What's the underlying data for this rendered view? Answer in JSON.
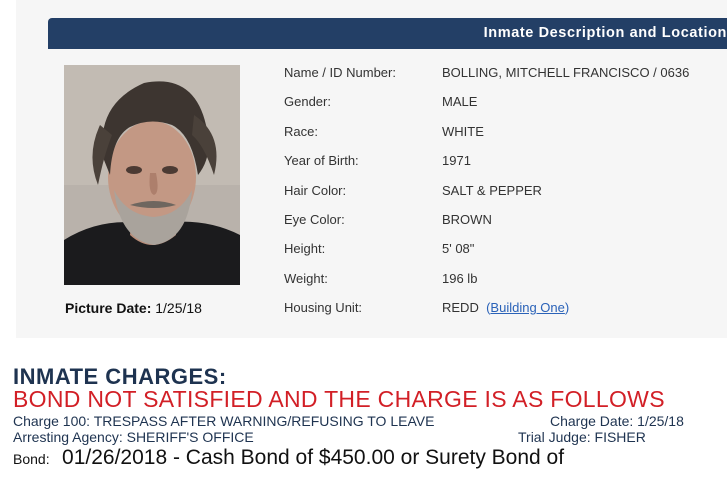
{
  "header": {
    "title": "Inmate Description and Location"
  },
  "photo": {
    "alt": "inmate-mugshot"
  },
  "picture_date": {
    "label": "Picture Date:",
    "value": "1/25/18"
  },
  "details": [
    {
      "label": "Name / ID Number:",
      "value": "BOLLING, MITCHELL FRANCISCO / 0636"
    },
    {
      "label": "Gender:",
      "value": "MALE"
    },
    {
      "label": "Race:",
      "value": "WHITE"
    },
    {
      "label": "Year of Birth:",
      "value": "1971"
    },
    {
      "label": "Hair Color:",
      "value": "SALT & PEPPER"
    },
    {
      "label": "Eye Color:",
      "value": "BROWN"
    },
    {
      "label": "Height:",
      "value": "5' 08\""
    },
    {
      "label": "Weight:",
      "value": "196 lb"
    },
    {
      "label": "Housing Unit:",
      "value": "REDD",
      "link": "Building One"
    }
  ],
  "charges": {
    "title": "INMATE CHARGES:",
    "bond_status": "BOND NOT SATISFIED AND THE CHARGE IS AS FOLLOWS",
    "charge": "Charge 100: TRESPASS AFTER WARNING/REFUSING TO LEAVE",
    "charge_date": "Charge Date: 1/25/18",
    "agency": "Arresting Agency: SHERIFF'S OFFICE",
    "judge": "Trial Judge: FISHER",
    "bond_label": "Bond:",
    "bond_value": "01/26/2018 - Cash Bond of $450.00 or Surety Bond of"
  },
  "colors": {
    "header_bg": "#233f66",
    "charges_title": "#1e3350",
    "bond_status": "#d21f26",
    "link": "#2a62b8"
  }
}
